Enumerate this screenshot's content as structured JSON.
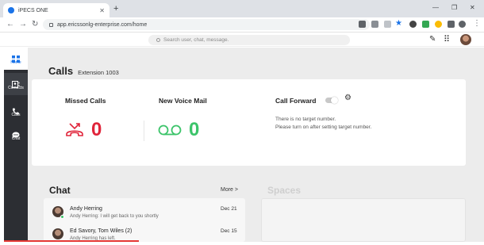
{
  "browser": {
    "tab_title": "iPECS ONE",
    "tab_close": "✕",
    "new_tab": "+",
    "url": "app.ericssonlg-enterprise.com/home",
    "win_min": "—",
    "win_max": "❐",
    "win_close": "✕"
  },
  "header": {
    "search_placeholder": "Search user, chat, message."
  },
  "sidebar": {
    "items": [
      {
        "label": "Home"
      },
      {
        "label": "Contacts"
      },
      {
        "label": "Calls"
      },
      {
        "label": "Chat"
      }
    ]
  },
  "calls": {
    "title": "Calls",
    "extension": "Extension 1003",
    "missed_label": "Missed Calls",
    "missed_count": "0",
    "voicemail_label": "New Voice Mail",
    "voicemail_count": "0",
    "forward_label": "Call Forward",
    "forward_enabled": false,
    "forward_msg_1": "There is no target number.",
    "forward_msg_2": "Please turn on after setting target number."
  },
  "chat": {
    "title": "Chat",
    "more_label": "More >",
    "items": [
      {
        "name": "Andy Herring",
        "message": "Andy Herring: I will get back to you shortly",
        "date": "Dec 21"
      },
      {
        "name": "Ed Savory, Tom Wiles (2)",
        "message": "Andy Herring has left.",
        "date": "Dec 15"
      }
    ]
  },
  "spaces": {
    "title": "Spaces"
  },
  "colors": {
    "missed": "#e0243a",
    "voicemail": "#3cc46a",
    "sidebar": "#2c2e33",
    "accent": "#1a73e8"
  }
}
